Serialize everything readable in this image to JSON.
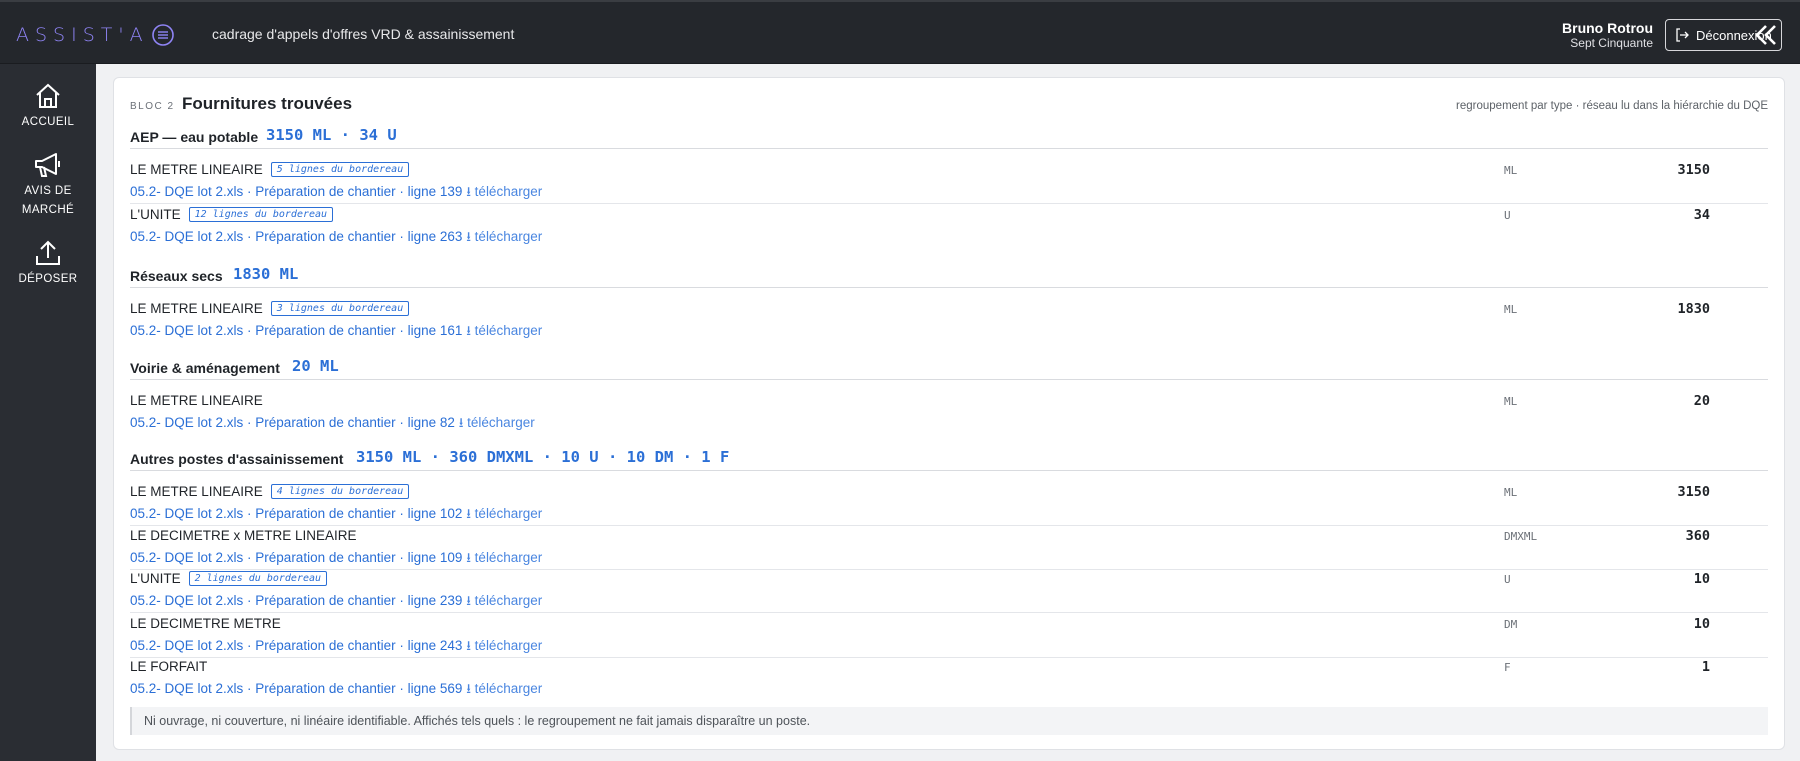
{
  "header": {
    "logo_text": "ASSIST'A",
    "subtitle": "cadrage d'appels d'offres VRD & assainissement",
    "user_name": "Bruno Rotrou",
    "user_org": "Sept Cinquante",
    "logout_label": "Déconnexion"
  },
  "sidebar": {
    "items": [
      {
        "label": "ACCUEIL",
        "icon": "home-icon"
      },
      {
        "label": "AVIS DE",
        "label2": "MARCHÉ",
        "icon": "megaphone-icon"
      },
      {
        "label": "DÉPOSER",
        "icon": "upload-icon"
      }
    ]
  },
  "card": {
    "bloc_label": "BLOC 2",
    "title": "Fournitures trouvées",
    "note": "regroupement par type · réseau lu dans la hiérarchie du DQE",
    "footnote": "Ni ouvrage, ni couverture, ni linéaire identifiable. Affichés tels quels : le regroupement ne fait jamais disparaître un poste."
  },
  "groups": [
    {
      "name": "AEP — eau potable",
      "total": "3150 ML · 34 U",
      "rows": [
        {
          "label": "LE METRE LINEAIRE",
          "badge": "5 lignes du bordereau",
          "source": "05.2- DQE lot 2.xls · Préparation de chantier · ligne 139",
          "download": "⭳ télécharger",
          "qty": "3150",
          "unit": "ML"
        },
        {
          "label": "L'UNITE",
          "badge": "12 lignes du bordereau",
          "source": "05.2- DQE lot 2.xls · Préparation de chantier · ligne 263",
          "download": "⭳ télécharger",
          "qty": "34",
          "unit": "U"
        }
      ]
    },
    {
      "name": "Réseaux secs",
      "total": "1830 ML",
      "rows": [
        {
          "label": "LE METRE LINEAIRE",
          "badge": "3 lignes du bordereau",
          "source": "05.2- DQE lot 2.xls · Préparation de chantier · ligne 161",
          "download": "⭳ télécharger",
          "qty": "1830",
          "unit": "ML"
        }
      ]
    },
    {
      "name": "Voirie & aménagement",
      "total": "20 ML",
      "rows": [
        {
          "label": "LE METRE LINEAIRE",
          "badge": "",
          "source": "05.2- DQE lot 2.xls · Préparation de chantier · ligne 82",
          "download": "⭳ télécharger",
          "qty": "20",
          "unit": "ML"
        }
      ]
    },
    {
      "name": "Autres postes d'assainissement",
      "total": "3150 ML · 360 DMXML · 10 U · 10 DM · 1 F",
      "rows": [
        {
          "label": "LE METRE LINEAIRE",
          "badge": "4 lignes du bordereau",
          "source": "05.2- DQE lot 2.xls · Préparation de chantier · ligne 102",
          "download": "⭳ télécharger",
          "qty": "3150",
          "unit": "ML"
        },
        {
          "label": "LE DECIMETRE x METRE LINEAIRE",
          "badge": "",
          "source": "05.2- DQE lot 2.xls · Préparation de chantier · ligne 109",
          "download": "⭳ télécharger",
          "qty": "360",
          "unit": "DMXML"
        },
        {
          "label": "L'UNITE",
          "badge": "2 lignes du bordereau",
          "source": "05.2- DQE lot 2.xls · Préparation de chantier · ligne 239",
          "download": "⭳ télécharger",
          "qty": "10",
          "unit": "U"
        },
        {
          "label": "LE DECIMETRE METRE",
          "badge": "",
          "source": "05.2- DQE lot 2.xls · Préparation de chantier · ligne 243",
          "download": "⭳ télécharger",
          "qty": "10",
          "unit": "DM"
        },
        {
          "label": "LE FORFAIT",
          "badge": "",
          "source": "05.2- DQE lot 2.xls · Préparation de chantier · ligne 569",
          "download": "⭳ télécharger",
          "qty": "1",
          "unit": "F"
        }
      ]
    }
  ],
  "colors": {
    "accent": "#2b6fd6",
    "logo": "#8f84f5",
    "topbar": "#24272c",
    "sidebar": "#2a2d33"
  }
}
